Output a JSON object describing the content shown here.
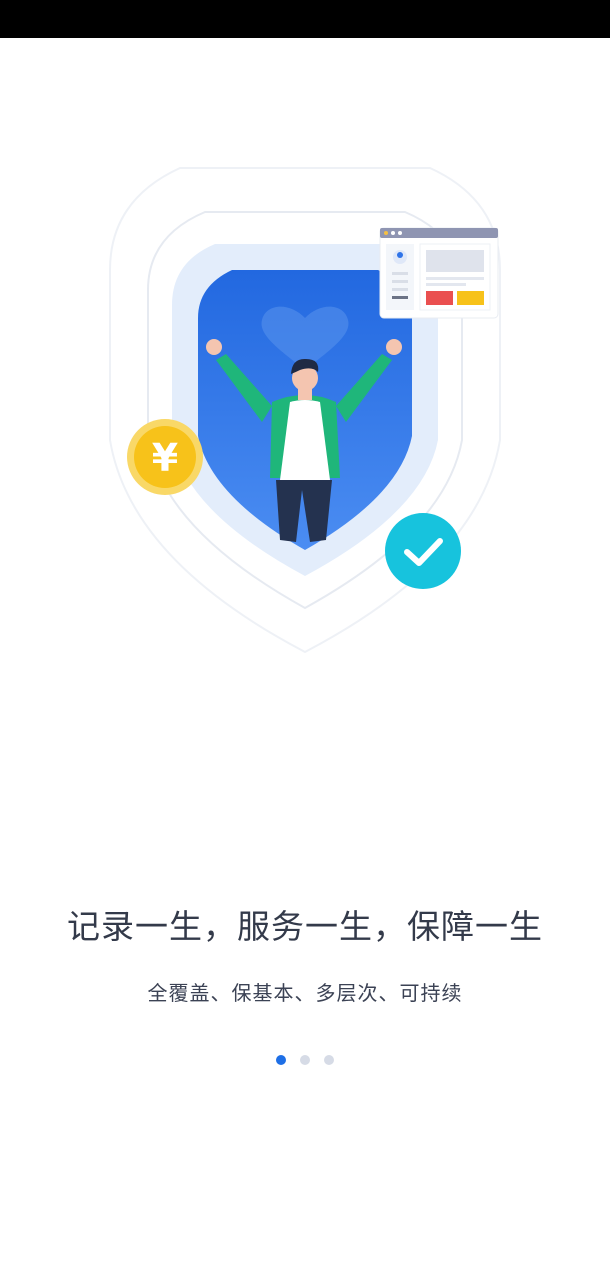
{
  "colors": {
    "status_bar": "#000000",
    "background": "#ffffff",
    "shield_blue": "#2f74e8",
    "shield_light": "#e3edfb",
    "coin_yellow": "#f7c21a",
    "check_cyan": "#17c3dd",
    "dot_active": "#1e6fe6",
    "dot_inactive": "#d6dbe6"
  },
  "icons": {
    "coin": "yuan-coin-icon",
    "check": "checkmark-circle-icon",
    "card": "profile-card-icon",
    "heart": "heart-icon"
  },
  "coin_symbol": "¥",
  "onboarding": {
    "headline": "记录一生，服务一生，保障一生",
    "subtitle": "全覆盖、保基本、多层次、可持续",
    "page_count": 3,
    "current_page": 1
  }
}
